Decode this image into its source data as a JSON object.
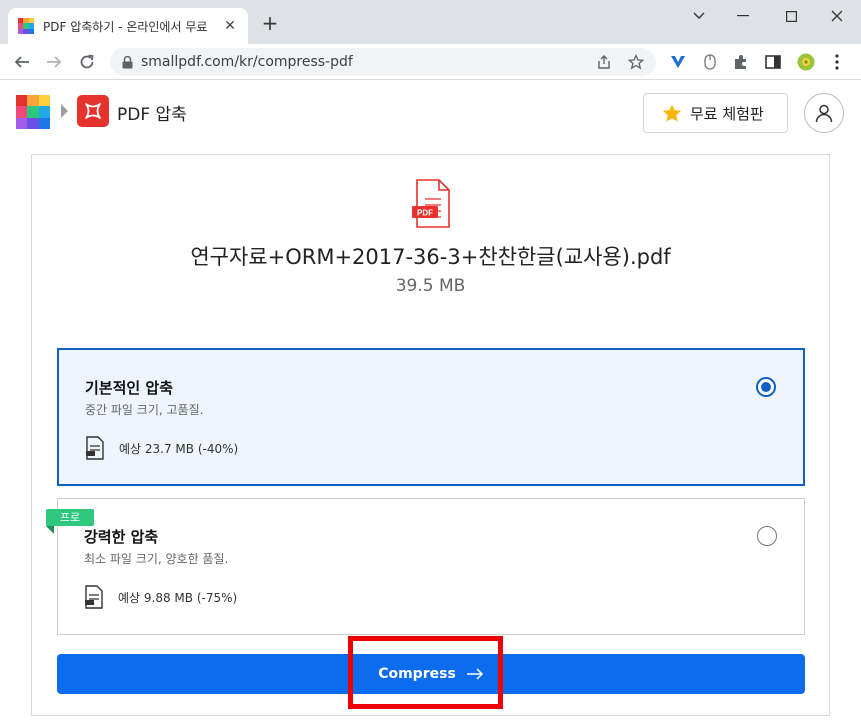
{
  "browser": {
    "tab_title": "PDF 압축하기 - 온라인에서 무료",
    "url": "smallpdf.com/kr/compress-pdf"
  },
  "header": {
    "tool_name": "PDF 압축",
    "trial_label": "무료 체험판"
  },
  "file": {
    "name": "연구자료+ORM+2017-36-3+찬찬한글(교사용).pdf",
    "size": "39.5 MB",
    "icon_label": "PDF"
  },
  "options": [
    {
      "title": "기본적인 압축",
      "description": "중간 파일 크기, 고품질.",
      "estimate": "예상 23.7 MB (-40%)",
      "selected": true
    },
    {
      "title": "강력한 압축",
      "description": "최소 파일 크기, 양호한 품질.",
      "estimate": "예상 9.88 MB (-75%)",
      "selected": false,
      "badge": "프로"
    }
  ],
  "actions": {
    "compress_label": "Compress"
  },
  "colors": {
    "accent": "#0b6cf0",
    "selected_border": "#1160c5",
    "pro_badge": "#2ec77e",
    "tool_red": "#e5322d",
    "highlight": "#ee0000"
  }
}
